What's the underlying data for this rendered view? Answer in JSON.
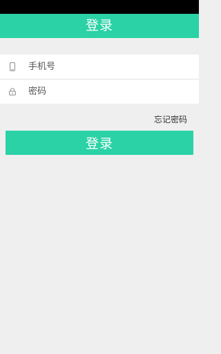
{
  "header": {
    "title": "登录"
  },
  "form": {
    "phone": {
      "icon": "phone-icon",
      "value": "",
      "placeholder": "手机号"
    },
    "password": {
      "icon": "lock-icon",
      "value": "",
      "placeholder": "密码"
    }
  },
  "links": {
    "forgot_password": "忘记密码"
  },
  "actions": {
    "login_label": "登录"
  },
  "colors": {
    "accent": "#2bd2a6",
    "status_bar": "#000000",
    "background": "#efefef",
    "card": "#ffffff"
  }
}
